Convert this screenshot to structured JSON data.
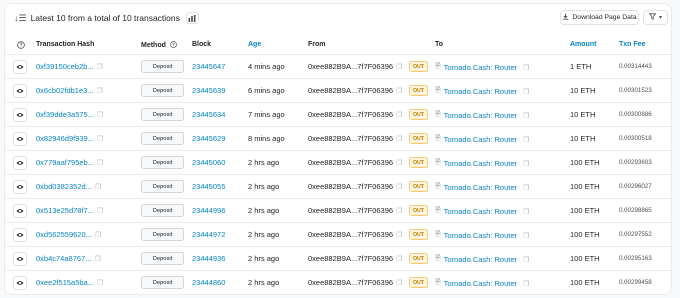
{
  "summary": {
    "text": "Latest 10 from a total of 10 transactions"
  },
  "toolbar": {
    "download_label": "Download Page Data"
  },
  "columns": {
    "hash": "Transaction Hash",
    "method": "Method",
    "block": "Block",
    "age": "Age",
    "from": "From",
    "to": "To",
    "amount": "Amount",
    "fee": "Txn Fee"
  },
  "rows": [
    {
      "hash": "0xf39150ceb2b...",
      "method": "Deposit",
      "block": "23445647",
      "age": "4 mins ago",
      "from": "0xee882B9A...7f7F06396",
      "dir": "OUT",
      "to": "Tornado.Cash: Router",
      "amount": "1 ETH",
      "fee": "0.00314443"
    },
    {
      "hash": "0x6cb02fdb1e3...",
      "method": "Deposit",
      "block": "23445639",
      "age": "6 mins ago",
      "from": "0xee882B9A...7f7F06396",
      "dir": "OUT",
      "to": "Tornado.Cash: Router",
      "amount": "10 ETH",
      "fee": "0.00301523"
    },
    {
      "hash": "0xf39dde3a575...",
      "method": "Deposit",
      "block": "23445634",
      "age": "7 mins ago",
      "from": "0xee882B9A...7f7F06396",
      "dir": "OUT",
      "to": "Tornado.Cash: Router",
      "amount": "10 ETH",
      "fee": "0.00300886"
    },
    {
      "hash": "0x82946d9f939...",
      "method": "Deposit",
      "block": "23445629",
      "age": "8 mins ago",
      "from": "0xee882B9A...7f7F06396",
      "dir": "OUT",
      "to": "Tornado.Cash: Router",
      "amount": "10 ETH",
      "fee": "0.00300518"
    },
    {
      "hash": "0x779aaf795eb...",
      "method": "Deposit",
      "block": "23445060",
      "age": "2 hrs ago",
      "from": "0xee882B9A...7f7F06396",
      "dir": "OUT",
      "to": "Tornado.Cash: Router",
      "amount": "100 ETH",
      "fee": "0.00293603"
    },
    {
      "hash": "0xbd0382352d...",
      "method": "Deposit",
      "block": "23445055",
      "age": "2 hrs ago",
      "from": "0xee882B9A...7f7F06396",
      "dir": "OUT",
      "to": "Tornado.Cash: Router",
      "amount": "100 ETH",
      "fee": "0.00296027"
    },
    {
      "hash": "0x513e25d78f7...",
      "method": "Deposit",
      "block": "23444996",
      "age": "2 hrs ago",
      "from": "0xee882B9A...7f7F06396",
      "dir": "OUT",
      "to": "Tornado.Cash: Router",
      "amount": "100 ETH",
      "fee": "0.00298865"
    },
    {
      "hash": "0xd562559620...",
      "method": "Deposit",
      "block": "23444972",
      "age": "2 hrs ago",
      "from": "0xee882B9A...7f7F06396",
      "dir": "OUT",
      "to": "Tornado.Cash: Router",
      "amount": "100 ETH",
      "fee": "0.00297552"
    },
    {
      "hash": "0xb4c74a8767...",
      "method": "Deposit",
      "block": "23444936",
      "age": "2 hrs ago",
      "from": "0xee882B9A...7f7F06396",
      "dir": "OUT",
      "to": "Tornado.Cash: Router",
      "amount": "100 ETH",
      "fee": "0.00295163"
    },
    {
      "hash": "0xee2f515a5ba...",
      "method": "Deposit",
      "block": "23444860",
      "age": "2 hrs ago",
      "from": "0xee882B9A...7f7F06396",
      "dir": "OUT",
      "to": "Tornado.Cash: Router",
      "amount": "100 ETH",
      "fee": "0.00299458"
    }
  ],
  "colors": {
    "link": "#0784c3",
    "out_badge_bg": "#fff4e0",
    "out_badge_text": "#b47d00",
    "border": "#e9ecef"
  }
}
